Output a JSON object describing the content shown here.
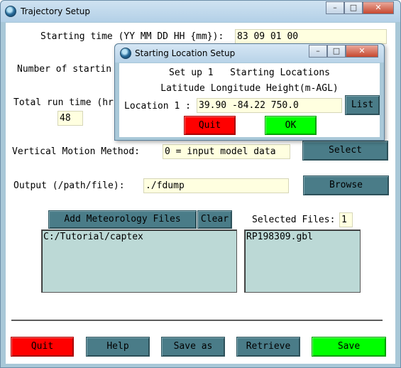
{
  "main_window": {
    "title": "Trajectory Setup",
    "controls": {
      "minimize": "–",
      "maximize": "□",
      "close": "✕"
    },
    "starting_time": {
      "label": "Starting time (YY MM DD HH {mm}):",
      "value": "83 09 01 00"
    },
    "num_locations": {
      "label": "Number of startin"
    },
    "run_time": {
      "label": "Total run time (hr",
      "value": "48"
    },
    "vertical_motion": {
      "label": "Vertical Motion Method:",
      "value": "0 = input model data",
      "button": "Select"
    },
    "output": {
      "label": "Output (/path/file):",
      "value": "./fdump",
      "button": "Browse"
    },
    "meteorology": {
      "add_button": "Add Meteorology Files",
      "clear_button": "Clear",
      "selected_label": "Selected Files:",
      "selected_count": "1",
      "directories": [
        "C:/Tutorial/captex"
      ],
      "files": [
        "RP198309.gbl"
      ]
    },
    "footer": {
      "quit": "Quit",
      "help": "Help",
      "save_as": "Save as",
      "retrieve": "Retrieve",
      "save": "Save"
    }
  },
  "dialog": {
    "title": "Starting Location Setup",
    "controls": {
      "minimize": "–",
      "maximize": "□",
      "close": "✕"
    },
    "heading1": "Set up 1   Starting Locations",
    "heading2": "Latitude Longitude Height(m-AGL)",
    "location_label": "Location 1 :",
    "location_value": "39.90 -84.22 750.0",
    "list_button": "List",
    "quit_button": "Quit",
    "ok_button": "OK"
  },
  "colors": {
    "window_frame": "#a9c8d8",
    "button_teal": "#4a7c88",
    "entry_yellow": "#ffffe0",
    "listbox_bg": "#bcd9d6",
    "quit_red": "#ff0000",
    "ok_green": "#00ff00"
  },
  "icons": {
    "app": "hysplit-globe-icon"
  }
}
